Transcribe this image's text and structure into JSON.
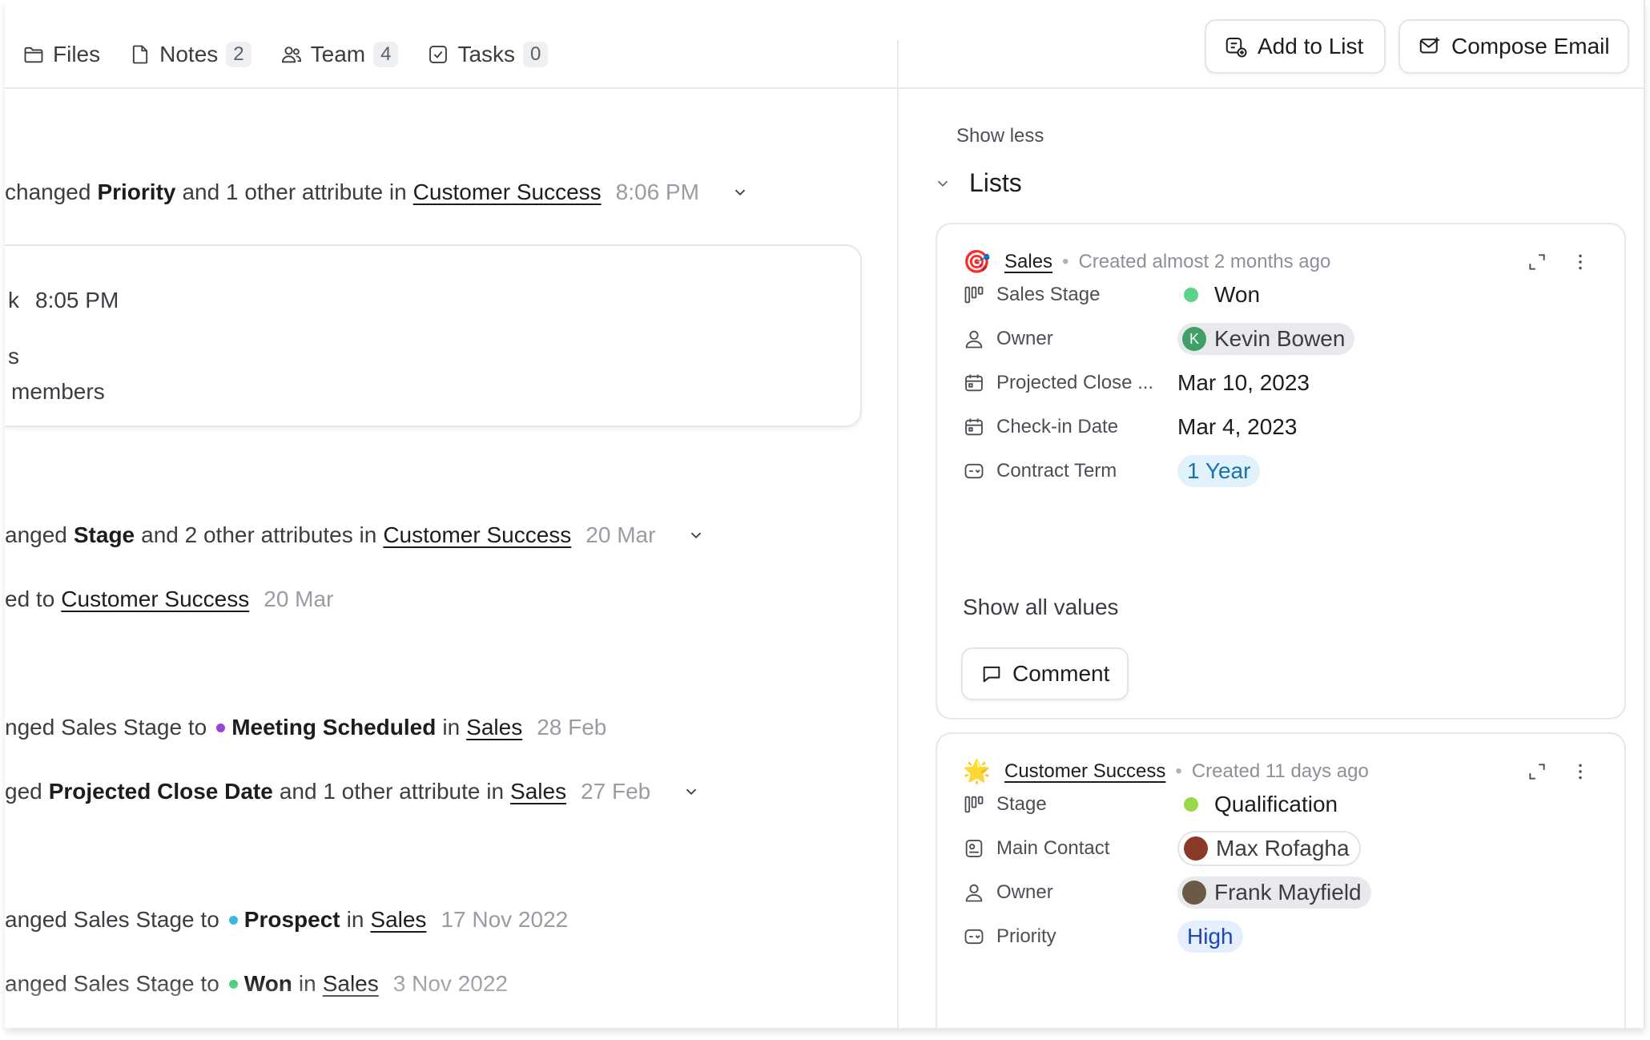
{
  "tabs": [
    {
      "label": "Files",
      "count": ""
    },
    {
      "label": "Notes",
      "count": "2"
    },
    {
      "label": "Team",
      "count": "4"
    },
    {
      "label": "Tasks",
      "count": "0"
    }
  ],
  "actions": {
    "add_to_list": "Add to List",
    "compose_email": "Compose Email"
  },
  "feed": {
    "row1": {
      "pre": "changed",
      "attr": "Priority",
      "mid": "and 1 other attribute in",
      "link": "Customer Success",
      "time": "8:06 PM"
    },
    "card": {
      "line1_a": "k",
      "line1_time": "8:05 PM",
      "line2": "s",
      "line3": "members"
    },
    "row2": {
      "pre": "anged",
      "attr": "Stage",
      "mid": "and 2 other attributes in",
      "link": "Customer Success",
      "time": "20 Mar"
    },
    "row3": {
      "pre": "ed to",
      "link": "Customer Success",
      "time": "20 Mar"
    },
    "row4": {
      "pre": "nged Sales Stage to",
      "value": "Meeting Scheduled",
      "mid": "in",
      "link": "Sales",
      "time": "28 Feb",
      "dot_color": "#9b43d6"
    },
    "row5": {
      "pre": "ged",
      "attr": "Projected Close Date",
      "mid": "and 1 other attribute in",
      "link": "Sales",
      "time": "27 Feb"
    },
    "row6": {
      "pre": "anged Sales Stage to",
      "value": "Prospect",
      "mid": "in",
      "link": "Sales",
      "time": "17 Nov 2022",
      "dot_color": "#39b7e0"
    },
    "row7": {
      "pre": "anged Sales Stage to",
      "value": "Won",
      "mid": "in",
      "link": "Sales",
      "time": "3 Nov 2022",
      "dot_color": "#3fcf73"
    }
  },
  "sidebar": {
    "show_less": "Show less",
    "lists_title": "Lists",
    "sales_card": {
      "emoji": "🎯",
      "name": "Sales",
      "created": "Created almost 2 months ago",
      "attrs": [
        {
          "label": "Sales Stage",
          "value": "Won",
          "dot_color": "#5cd38b"
        },
        {
          "label": "Owner",
          "value": "Kevin Bowen",
          "avatar_letter": "K",
          "avatar_color": "#3f9f67"
        },
        {
          "label": "Projected Close ...",
          "value": "Mar 10, 2023"
        },
        {
          "label": "Check-in Date",
          "value": "Mar 4, 2023"
        },
        {
          "label": "Contract Term",
          "value": "1 Year"
        }
      ],
      "show_all": "Show all values",
      "comment": "Comment"
    },
    "cs_card": {
      "emoji": "🌟",
      "name": "Customer Success",
      "created": "Created 11 days ago",
      "attrs": [
        {
          "label": "Stage",
          "value": "Qualification",
          "dot_color": "#9ad84a"
        },
        {
          "label": "Main Contact",
          "value": "Max Rofagha"
        },
        {
          "label": "Owner",
          "value": "Frank Mayfield"
        },
        {
          "label": "Priority",
          "value": "High"
        }
      ]
    }
  }
}
